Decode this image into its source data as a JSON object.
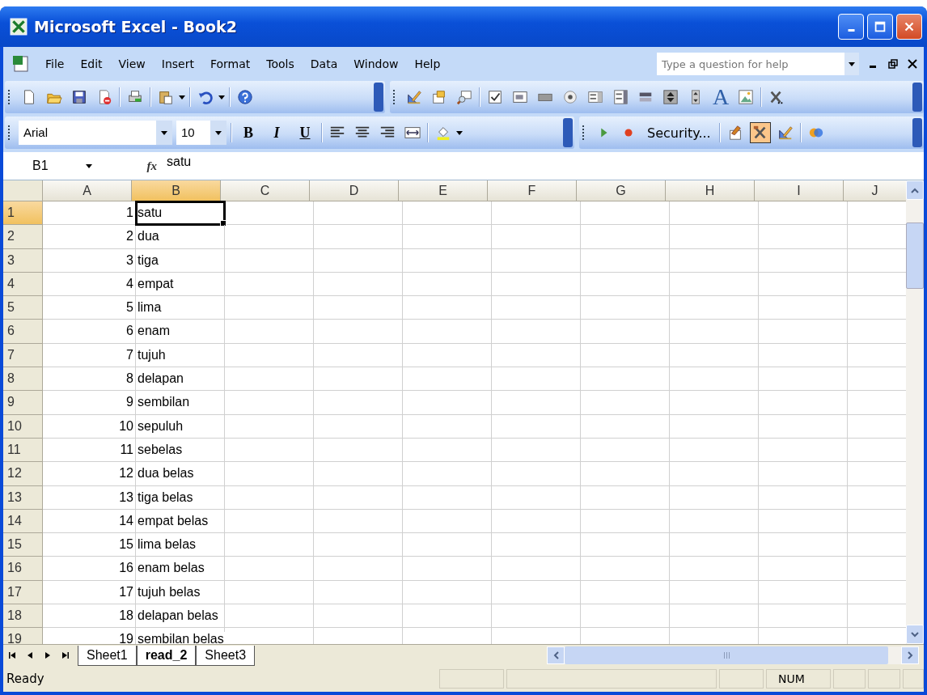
{
  "window": {
    "title": "Microsoft Excel - Book2"
  },
  "menu": [
    "File",
    "Edit",
    "View",
    "Insert",
    "Format",
    "Tools",
    "Data",
    "Window",
    "Help"
  ],
  "help_search": {
    "placeholder": "Type a question for help"
  },
  "toolbar_standard": [
    {
      "kind": "new",
      "pressed": false
    },
    {
      "kind": "open",
      "pressed": false
    },
    {
      "kind": "save",
      "pressed": false
    },
    {
      "kind": "permission",
      "pressed": false
    },
    {
      "kind": "separator"
    },
    {
      "kind": "print",
      "pressed": false
    },
    {
      "kind": "separator"
    },
    {
      "kind": "paste",
      "pressed": false
    },
    {
      "kind": "dropdown"
    },
    {
      "kind": "separator"
    },
    {
      "kind": "undo",
      "pressed": false
    },
    {
      "kind": "dropdown"
    },
    {
      "kind": "separator"
    },
    {
      "kind": "help",
      "pressed": false
    },
    {
      "kind": "overflow"
    }
  ],
  "toolbar_forms": [
    {
      "kind": "design",
      "pressed": false
    },
    {
      "kind": "properties",
      "pressed": false
    },
    {
      "kind": "code",
      "pressed": false
    },
    {
      "kind": "separator"
    },
    {
      "kind": "checkbox",
      "pressed": false
    },
    {
      "kind": "textbox",
      "pressed": false
    },
    {
      "kind": "command",
      "pressed": false
    },
    {
      "kind": "option",
      "pressed": false
    },
    {
      "kind": "listbox",
      "pressed": false
    },
    {
      "kind": "combobox",
      "pressed": false
    },
    {
      "kind": "toggle",
      "pressed": false
    },
    {
      "kind": "spin",
      "pressed": false
    },
    {
      "kind": "scrollbar",
      "pressed": false
    },
    {
      "kind": "label",
      "text": "A",
      "pressed": false
    },
    {
      "kind": "image",
      "pressed": false
    },
    {
      "kind": "separator"
    },
    {
      "kind": "more",
      "pressed": false
    },
    {
      "kind": "overflow"
    }
  ],
  "formatting": {
    "font": "Arial",
    "size": "10",
    "bold": "B",
    "italic": "I",
    "underline": "U"
  },
  "toolbar_format_tail": [
    {
      "kind": "separator"
    },
    {
      "kind": "left",
      "pressed": false
    },
    {
      "kind": "center",
      "pressed": false
    },
    {
      "kind": "right",
      "pressed": false
    },
    {
      "kind": "merge",
      "pressed": false
    },
    {
      "kind": "separator"
    },
    {
      "kind": "fill",
      "pressed": false
    },
    {
      "kind": "dropdown"
    },
    {
      "kind": "overflow"
    }
  ],
  "toolbar_vb": [
    {
      "kind": "run",
      "pressed": false
    },
    {
      "kind": "record",
      "pressed": false
    },
    {
      "kind": "security",
      "text": "Security...",
      "pressed": false
    },
    {
      "kind": "separator"
    },
    {
      "kind": "editor",
      "pressed": false
    },
    {
      "kind": "tools",
      "pressed": true
    },
    {
      "kind": "design",
      "pressed": false
    },
    {
      "kind": "separator"
    },
    {
      "kind": "script",
      "pressed": false
    },
    {
      "kind": "overflow"
    }
  ],
  "formula_bar": {
    "name_box": "B1",
    "fx": "fx",
    "value": "satu"
  },
  "columns": [
    {
      "label": "A",
      "selected": false
    },
    {
      "label": "B",
      "selected": true
    },
    {
      "label": "C",
      "selected": false
    },
    {
      "label": "D",
      "selected": false
    },
    {
      "label": "E",
      "selected": false
    },
    {
      "label": "F",
      "selected": false
    },
    {
      "label": "G",
      "selected": false
    },
    {
      "label": "H",
      "selected": false
    },
    {
      "label": "I",
      "selected": false
    },
    {
      "label": "J",
      "selected": false
    }
  ],
  "rows": [
    {
      "header": "1",
      "selected": true,
      "a": "1",
      "b": "satu"
    },
    {
      "header": "2",
      "selected": false,
      "a": "2",
      "b": "dua"
    },
    {
      "header": "3",
      "selected": false,
      "a": "3",
      "b": "tiga"
    },
    {
      "header": "4",
      "selected": false,
      "a": "4",
      "b": "empat"
    },
    {
      "header": "5",
      "selected": false,
      "a": "5",
      "b": "lima"
    },
    {
      "header": "6",
      "selected": false,
      "a": "6",
      "b": "enam"
    },
    {
      "header": "7",
      "selected": false,
      "a": "7",
      "b": "tujuh"
    },
    {
      "header": "8",
      "selected": false,
      "a": "8",
      "b": "delapan"
    },
    {
      "header": "9",
      "selected": false,
      "a": "9",
      "b": "sembilan"
    },
    {
      "header": "10",
      "selected": false,
      "a": "10",
      "b": "sepuluh"
    },
    {
      "header": "11",
      "selected": false,
      "a": "11",
      "b": "sebelas"
    },
    {
      "header": "12",
      "selected": false,
      "a": "12",
      "b": "dua belas"
    },
    {
      "header": "13",
      "selected": false,
      "a": "13",
      "b": "tiga belas"
    },
    {
      "header": "14",
      "selected": false,
      "a": "14",
      "b": "empat belas"
    },
    {
      "header": "15",
      "selected": false,
      "a": "15",
      "b": "lima belas"
    },
    {
      "header": "16",
      "selected": false,
      "a": "16",
      "b": "enam belas"
    },
    {
      "header": "17",
      "selected": false,
      "a": "17",
      "b": "tujuh belas"
    },
    {
      "header": "18",
      "selected": false,
      "a": "18",
      "b": "delapan belas"
    },
    {
      "header": "19",
      "selected": false,
      "a": "19",
      "b": "sembilan belas"
    }
  ],
  "sheet_tabs": [
    {
      "label": "Sheet1",
      "selected": false
    },
    {
      "label": "read_2",
      "selected": true
    },
    {
      "label": "Sheet3",
      "selected": false
    }
  ],
  "status_bar": {
    "status": "Ready",
    "num": "NUM"
  }
}
